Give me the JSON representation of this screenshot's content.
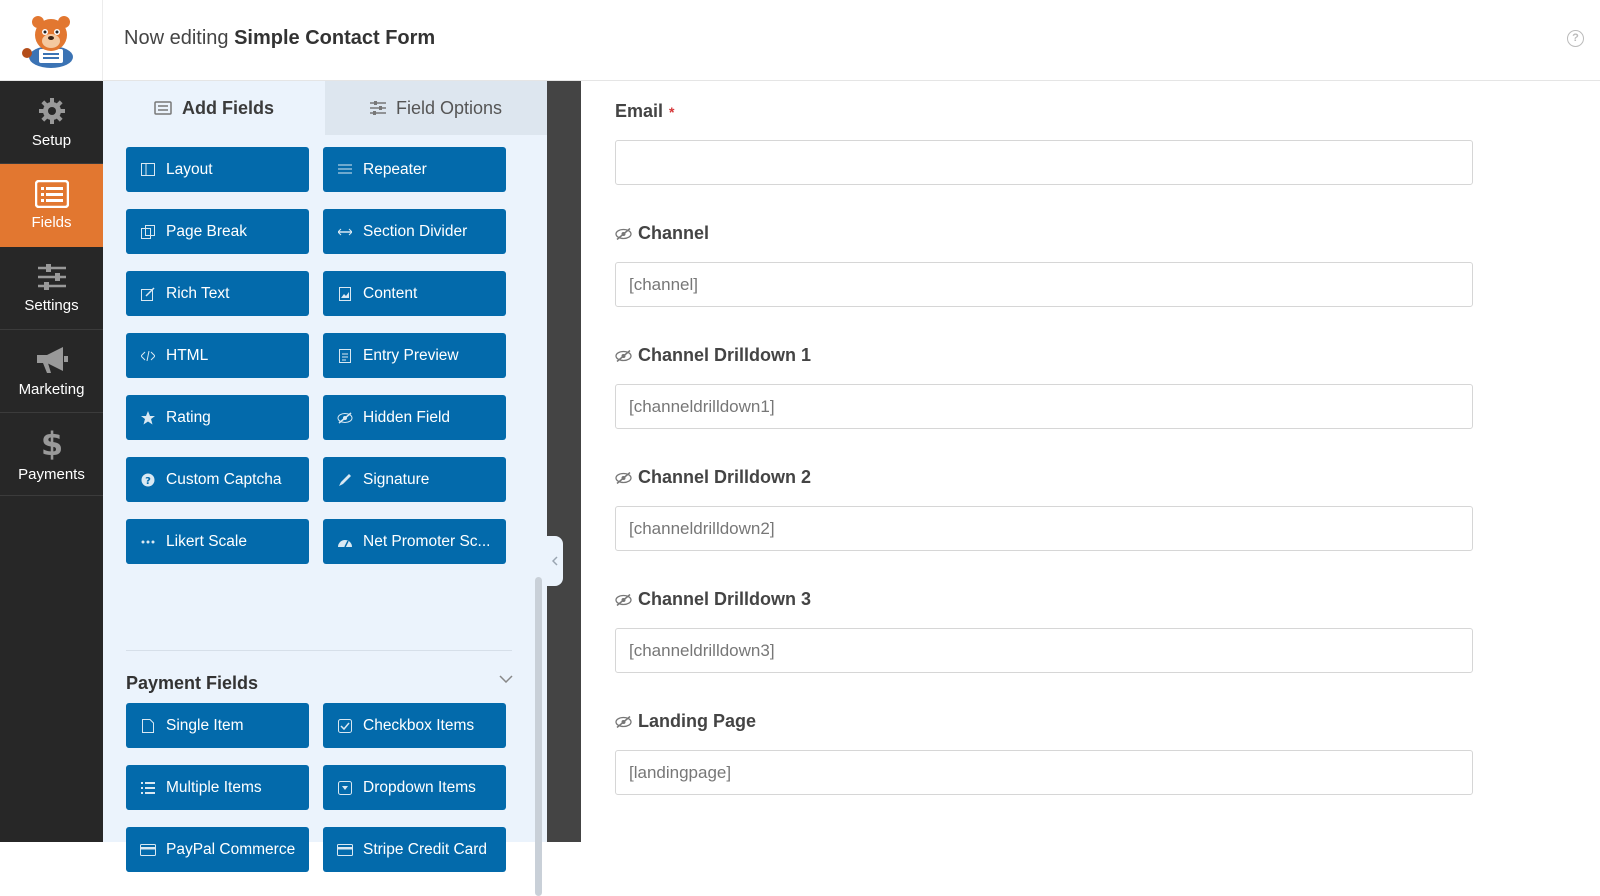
{
  "header": {
    "prefix": "Now editing",
    "form_name": "Simple Contact Form",
    "help": "?"
  },
  "nav": [
    {
      "label": "Setup",
      "icon": "gear-icon"
    },
    {
      "label": "Fields",
      "icon": "fields-icon"
    },
    {
      "label": "Settings",
      "icon": "sliders-icon"
    },
    {
      "label": "Marketing",
      "icon": "megaphone-icon"
    },
    {
      "label": "Payments",
      "icon": "dollar-icon"
    }
  ],
  "tabs": {
    "add_fields": "Add Fields",
    "field_options": "Field Options"
  },
  "fields": [
    {
      "label": "Layout",
      "icon": "layout-icon"
    },
    {
      "label": "Repeater",
      "icon": "repeater-icon"
    },
    {
      "label": "Page Break",
      "icon": "page-break-icon"
    },
    {
      "label": "Section Divider",
      "icon": "section-divider-icon"
    },
    {
      "label": "Rich Text",
      "icon": "rich-text-icon"
    },
    {
      "label": "Content",
      "icon": "content-icon"
    },
    {
      "label": "HTML",
      "icon": "code-icon"
    },
    {
      "label": "Entry Preview",
      "icon": "entry-preview-icon"
    },
    {
      "label": "Rating",
      "icon": "star-icon"
    },
    {
      "label": "Hidden Field",
      "icon": "eye-slash-icon"
    },
    {
      "label": "Custom Captcha",
      "icon": "question-icon"
    },
    {
      "label": "Signature",
      "icon": "pen-icon"
    },
    {
      "label": "Likert Scale",
      "icon": "ellipsis-icon"
    },
    {
      "label": "Net Promoter Sc...",
      "icon": "gauge-icon"
    }
  ],
  "payment_section": {
    "title": "Payment Fields",
    "fields": [
      {
        "label": "Single Item",
        "icon": "file-icon"
      },
      {
        "label": "Checkbox Items",
        "icon": "checkbox-icon"
      },
      {
        "label": "Multiple Items",
        "icon": "list-icon"
      },
      {
        "label": "Dropdown Items",
        "icon": "dropdown-icon"
      },
      {
        "label": "PayPal Commerce",
        "icon": "card-icon"
      },
      {
        "label": "Stripe Credit Card",
        "icon": "card-icon"
      }
    ]
  },
  "preview": {
    "email_label": "Email",
    "required_mark": "*",
    "fields": [
      {
        "label": "Channel",
        "value": "[channel]"
      },
      {
        "label": "Channel Drilldown 1",
        "value": "[channeldrilldown1]"
      },
      {
        "label": "Channel Drilldown 2",
        "value": "[channeldrilldown2]"
      },
      {
        "label": "Channel Drilldown 3",
        "value": "[channeldrilldown3]"
      },
      {
        "label": "Landing Page",
        "value": "[landingpage]"
      }
    ]
  },
  "colors": {
    "accent": "#e27730",
    "button": "#036aab",
    "sidebar": "#272727"
  }
}
